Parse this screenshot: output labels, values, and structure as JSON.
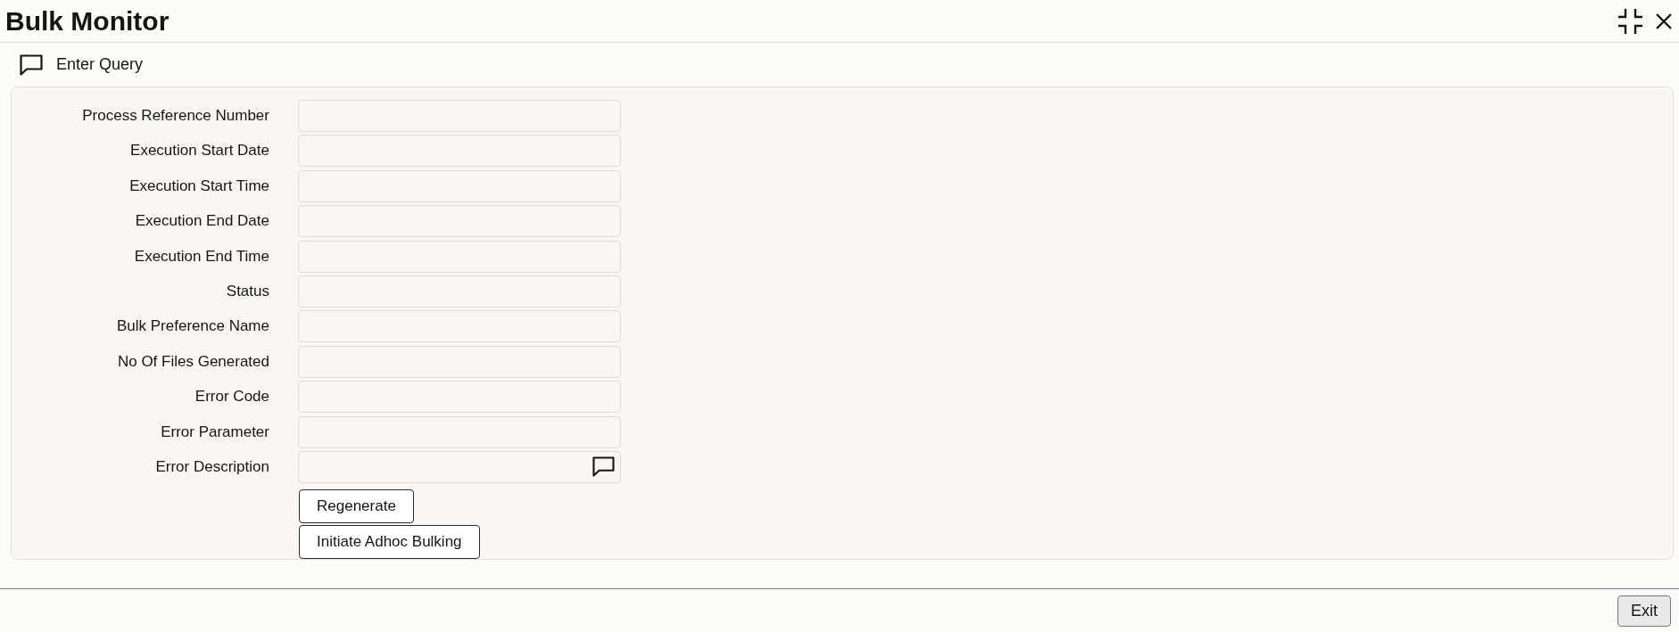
{
  "window": {
    "title": "Bulk Monitor"
  },
  "toolbar": {
    "enter_query": "Enter Query"
  },
  "form": {
    "fields": [
      {
        "label": "Process Reference Number",
        "kind": "text"
      },
      {
        "label": "Execution Start Date",
        "kind": "text"
      },
      {
        "label": "Execution Start Time",
        "kind": "text"
      },
      {
        "label": "Execution End Date",
        "kind": "text"
      },
      {
        "label": "Execution End Time",
        "kind": "text"
      },
      {
        "label": "Status",
        "kind": "text"
      },
      {
        "label": "Bulk Preference Name",
        "kind": "text"
      },
      {
        "label": "No Of Files Generated",
        "kind": "text"
      },
      {
        "label": "Error Code",
        "kind": "text"
      },
      {
        "label": "Error Parameter",
        "kind": "text"
      },
      {
        "label": "Error Description",
        "kind": "text-popup"
      }
    ],
    "actions": [
      "Regenerate",
      "Initiate Adhoc Bulking"
    ]
  },
  "footer": {
    "buttons": [
      "Exit"
    ]
  }
}
